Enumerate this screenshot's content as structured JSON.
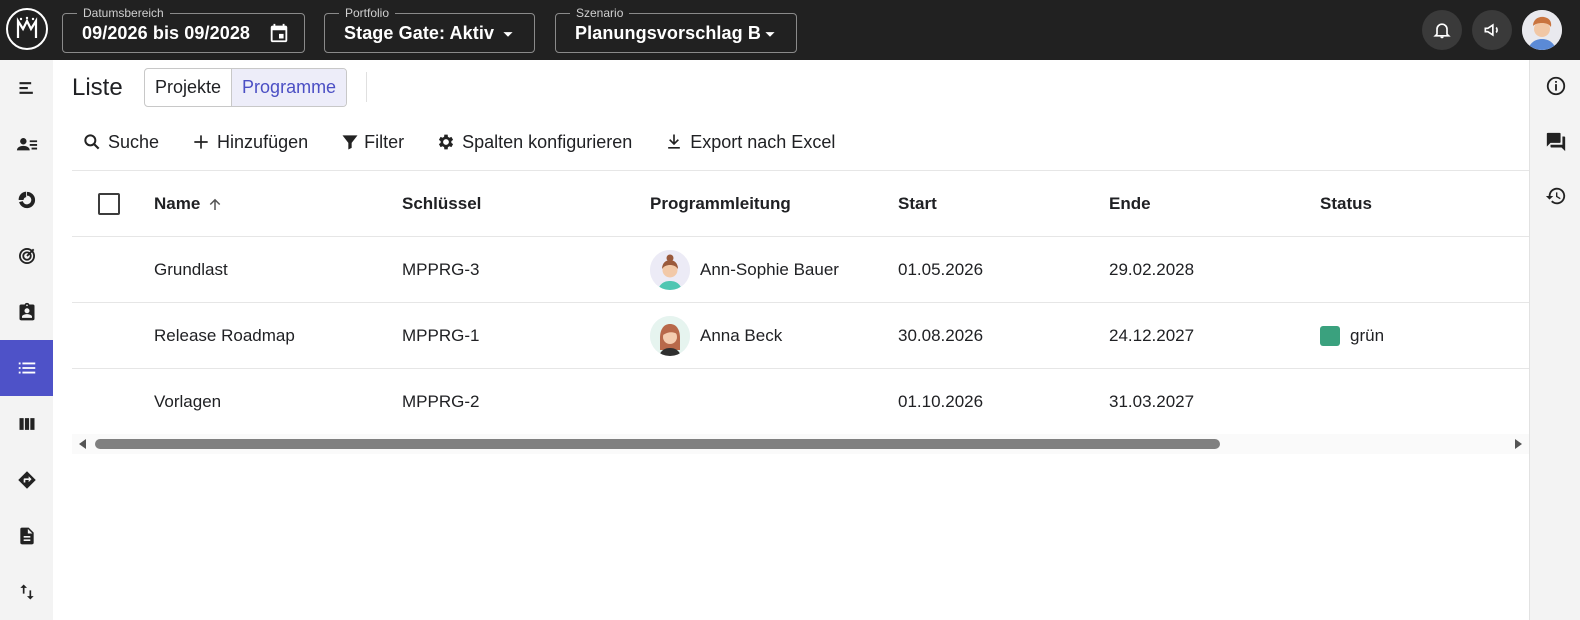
{
  "topbar": {
    "date_range": {
      "label": "Datumsbereich",
      "value": "09/2026 bis 09/2028"
    },
    "portfolio": {
      "label": "Portfolio",
      "value": "Stage Gate: Aktiv"
    },
    "scenario": {
      "label": "Szenario",
      "value": "Planungsvorschlag B"
    },
    "icons": [
      "notification-bell-icon",
      "announcement-megaphone-icon",
      "user-avatar"
    ]
  },
  "page": {
    "title": "Liste",
    "tabs": [
      {
        "label": "Projekte",
        "selected": false
      },
      {
        "label": "Programme",
        "selected": true
      }
    ]
  },
  "toolbar": {
    "search": "Suche",
    "add": "Hinzufügen",
    "filter": "Filter",
    "columns": "Spalten konfigurieren",
    "export": "Export nach Excel"
  },
  "table": {
    "columns": [
      "Name",
      "Schlüssel",
      "Programmleitung",
      "Start",
      "Ende",
      "Status"
    ],
    "sort": {
      "column": "Name",
      "direction": "asc"
    },
    "rows": [
      {
        "name": "Grundlast",
        "key": "MPPRG-3",
        "lead": "Ann-Sophie Bauer",
        "start": "01.05.2026",
        "end": "29.02.2028",
        "status": ""
      },
      {
        "name": "Release Roadmap",
        "key": "MPPRG-1",
        "lead": "Anna Beck",
        "start": "30.08.2026",
        "end": "24.12.2027",
        "status": "grün"
      },
      {
        "name": "Vorlagen",
        "key": "MPPRG-2",
        "lead": "",
        "start": "01.10.2026",
        "end": "31.03.2027",
        "status": ""
      }
    ]
  },
  "colors": {
    "topbar_bg": "#212121",
    "accent": "#4e52c8",
    "status_green": "#3aa17e"
  }
}
